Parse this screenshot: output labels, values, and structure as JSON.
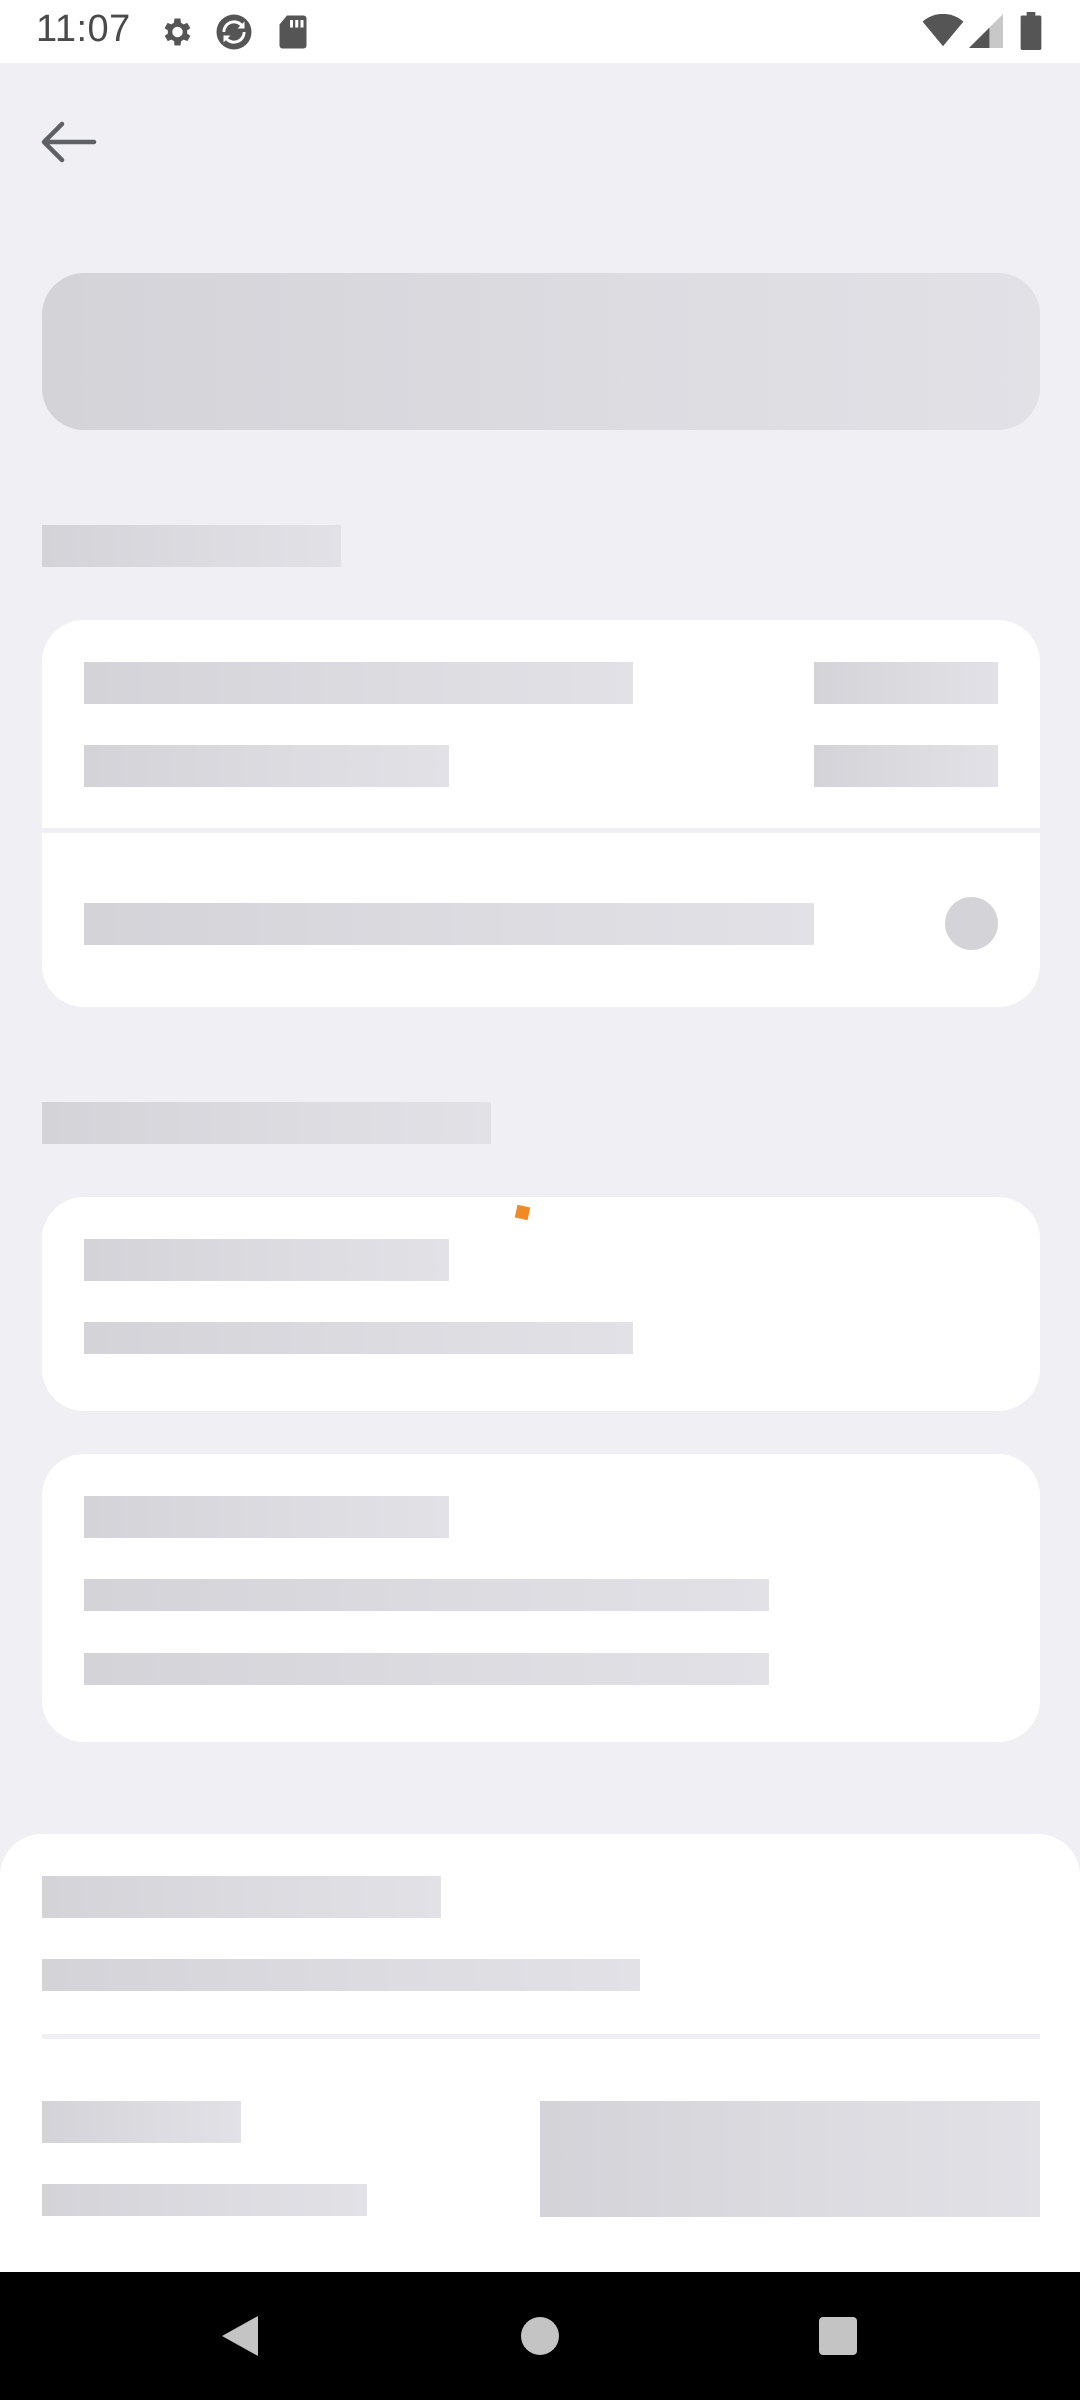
{
  "status_bar": {
    "time": "11:07",
    "icons": [
      "gear-icon",
      "sync-icon",
      "sd-card-icon",
      "wifi-icon",
      "signal-icon",
      "battery-icon"
    ]
  },
  "header": {
    "back_icon": "arrow-left-icon"
  },
  "colors": {
    "background": "#efeff4",
    "card": "#ffffff",
    "skeleton": "#d3d3d8",
    "accent_dot": "#f08a24",
    "nav_bar": "#000000"
  },
  "navigation_bar": {
    "buttons": [
      "back-triangle-icon",
      "home-circle-icon",
      "recents-square-icon"
    ]
  }
}
